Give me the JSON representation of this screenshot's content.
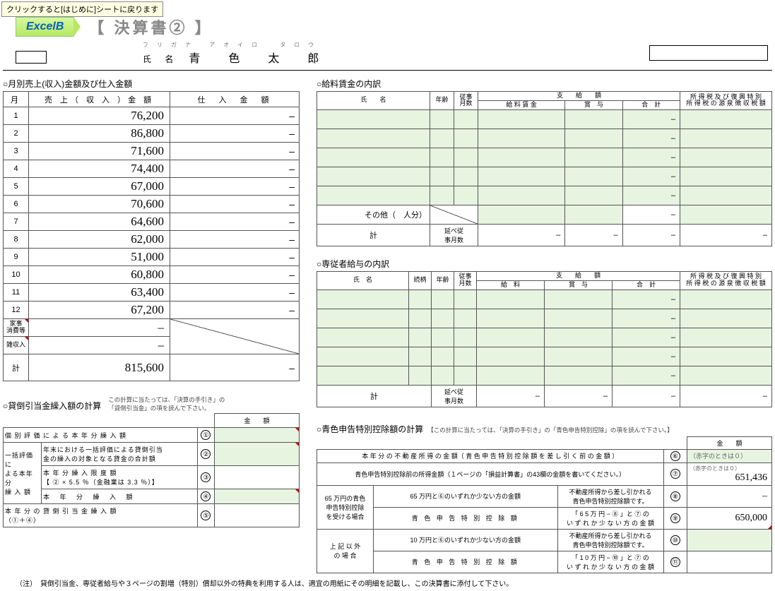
{
  "tooltip": "クリックすると[はじめに]シートに戻ります",
  "logo": "ExcelB",
  "title": "【 決算書② 】",
  "furigana_label": "フリガナ",
  "furigana": "アオイロ　タロウ",
  "name_label": "氏 名",
  "name": "青　色　太　郎",
  "sec1_title": "○月別売上(収入)金額及び仕入金額",
  "sales_headers": {
    "month": "月",
    "sales": "売 上（ 収 入 ）金 額",
    "shiire": "仕　入　金　額"
  },
  "sales": [
    {
      "m": "1",
      "v": "76,200",
      "s": "–"
    },
    {
      "m": "2",
      "v": "86,800",
      "s": "–"
    },
    {
      "m": "3",
      "v": "71,600",
      "s": "–"
    },
    {
      "m": "4",
      "v": "74,400",
      "s": "–"
    },
    {
      "m": "5",
      "v": "67,000",
      "s": "–"
    },
    {
      "m": "6",
      "v": "70,600",
      "s": "–"
    },
    {
      "m": "7",
      "v": "64,600",
      "s": "–"
    },
    {
      "m": "8",
      "v": "62,000",
      "s": "–"
    },
    {
      "m": "9",
      "v": "51,000",
      "s": "–"
    },
    {
      "m": "10",
      "v": "60,800",
      "s": "–"
    },
    {
      "m": "11",
      "v": "63,400",
      "s": "–"
    },
    {
      "m": "12",
      "v": "67,200",
      "s": "–"
    }
  ],
  "sales_sub1": "家事\n消費等",
  "sales_sub2": "雑収入",
  "sales_total_label": "計",
  "sales_total": "815,600",
  "dash": "–",
  "sec2_title": "○給料賃金の内訳",
  "wage_headers": {
    "name": "氏　　名",
    "age": "年齢",
    "months": "従事\n月数",
    "pay_top": "支　　給　　額",
    "pay1": "給 料 賃 金",
    "pay2": "賞　与",
    "pay3": "合　計",
    "tax": "所 得 税 及 び 復 興 特 別\n所 得 税 の 源 泉 徴 収 税 額"
  },
  "wage_other": "その他（",
  "wage_other_unit": "人分）",
  "wage_total": "計",
  "wage_total_sub": "延べ従\n事月数",
  "sec3_title": "○専従者給与の内訳",
  "sen_headers": {
    "name": "氏　名",
    "rel": "続柄",
    "age": "年齢",
    "months": "従事\n月数",
    "pay_top": "支　　給　　額",
    "pay1": "給　料",
    "pay2": "賞　与",
    "pay3": "合　計",
    "tax": "所 得 税 及 び 復 興 特 別\n所 得 税 の 源 泉 徴 収 税 額"
  },
  "sec4_title": "○貸倒引当金繰入額の計算",
  "sec4_note": "この計算に当たっては、「決算の手引き」の\n「貸倒引当金」の項を読んで下さい。",
  "ded_header_amt": "金　　額",
  "ded": {
    "r1": "個 別 評 価 に よ る 本 年 分 繰 入 額",
    "r2a": "一括評価に",
    "r2b": "よる本年分",
    "r2c": "繰 入 額",
    "r2_1": "年末における一括評価による貸倒引当\n金の繰入の対象となる貸金の合計額",
    "r2_2": "本 年 分 繰 入 限 度 額\n【 ② × 5.5 ％（金融業は 3.3 ％）】",
    "r2_3": "本 年 分 繰 入 額",
    "r3": "本 年 分 の 貸 倒 引 当 金 繰 入 額\n（①＋④）"
  },
  "sec5_title": "○青色申告特別控除額の計算",
  "sec5_note": "【この計算に当たっては、「決算の手引き」の「青色申告特別控除」の項を読んで下さい。】",
  "aoiro": {
    "r6": "本 年 分 の 不 動 産 所 得 の 金 額（ 青 色 申 告 特 別 控 除 額 を 差 し 引 く 前 の 金 額 ）",
    "r7": "青色申告特別控除前の所得金額（１ページの「損益計算書」の43欄の金額を書いてください。）",
    "r8a": "65 万円の青色\n申告特別控除\nを受ける場合",
    "r8_1": "65 万円と⑥のいずれか少ない方の金額",
    "r8_1n": "不動産所得から差し引かれる\n青色申告特別控除額です。",
    "r8_2": "青 色 申 告 特 別 控 除 額",
    "r8_2n": "「 6 5 万 円 − ⑧ 」と ⑦ の\nい ず れ か 少 な い 方 の 金 額",
    "r9a": "上 記 以 外\nの 場 合",
    "r9_1": "10 万円と⑥のいずれか少ない方の金額",
    "r9_1n": "不動産所得から差し引かれる\n青色申告特別控除額です。",
    "r9_2": "青 色 申 告 特 別 控 除 額",
    "r9_2n": "「 1 0 万 円 − ⑩ 」と ⑦ の\nい ず れ か 少 な い 方 の 金 額",
    "hint": "（赤字のときは０）",
    "v7": "651,436",
    "v8": "–",
    "v9": "650,000"
  },
  "footer": "（注）　貸倒引当金、専従者給与や３ページの割増（特別）償却以外の特典を利用する人は、適宜の用紙にその明細を記載し、この決算書に添付して下さい。",
  "chart_data": {
    "type": "table",
    "title": "月別売上(収入)金額",
    "xlabel": "月",
    "ylabel": "売上(収入)金額",
    "categories": [
      "1",
      "2",
      "3",
      "4",
      "5",
      "6",
      "7",
      "8",
      "9",
      "10",
      "11",
      "12"
    ],
    "values": [
      76200,
      86800,
      71600,
      74400,
      67000,
      70600,
      64600,
      62000,
      51000,
      60800,
      63400,
      67200
    ],
    "total": 815600
  }
}
